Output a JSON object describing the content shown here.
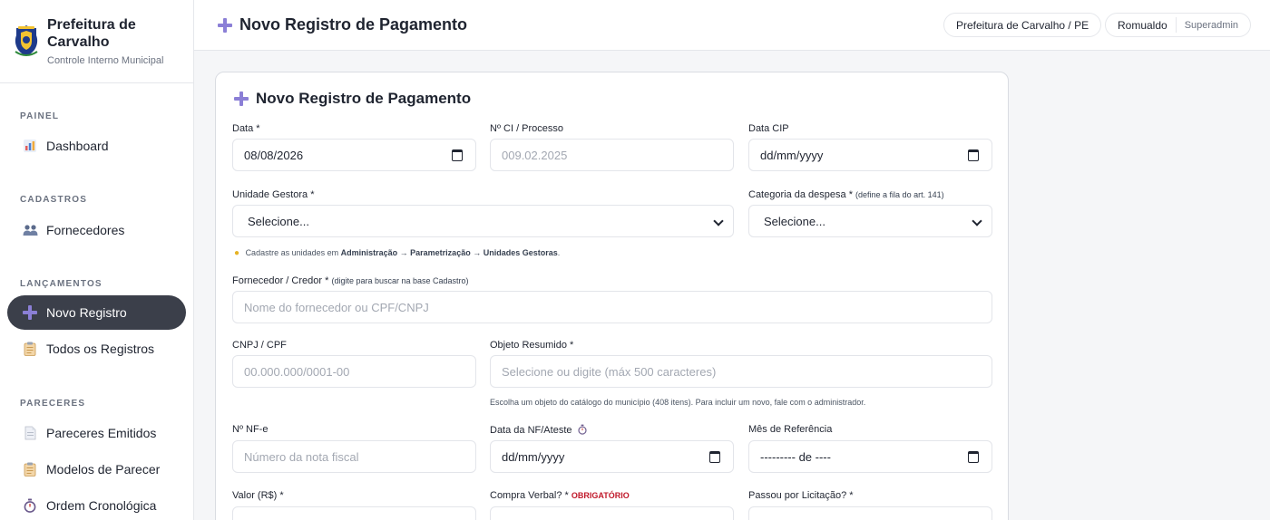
{
  "brand": {
    "title": "Prefeitura de Carvalho",
    "subtitle": "Controle Interno Municipal"
  },
  "sidebar": {
    "sections": [
      {
        "label": "PAINEL"
      },
      {
        "label": "CADASTROS"
      },
      {
        "label": "LANÇAMENTOS"
      },
      {
        "label": "PARECERES"
      }
    ],
    "items": [
      {
        "label": "Dashboard",
        "icon": "bar-chart-icon"
      },
      {
        "label": "Fornecedores",
        "icon": "users-icon"
      },
      {
        "label": "Novo Registro",
        "icon": "plus-icon"
      },
      {
        "label": "Todos os Registros",
        "icon": "clipboard-icon"
      },
      {
        "label": "Pareceres Emitidos",
        "icon": "document-icon"
      },
      {
        "label": "Modelos de Parecer",
        "icon": "clipboard-icon"
      },
      {
        "label": "Ordem Cronológica",
        "icon": "stopwatch-icon"
      }
    ]
  },
  "topbar": {
    "title": "Novo Registro de Pagamento",
    "org": "Prefeitura de Carvalho / PE",
    "user": "Romualdo",
    "role": "Superadmin"
  },
  "form": {
    "title": "Novo Registro de Pagamento",
    "data_label": "Data *",
    "data_value": "08/08/2026",
    "ci_label": "Nº CI / Processo",
    "ci_placeholder": "009.02.2025",
    "cip_label": "Data CIP",
    "cip_value": "dd/mm/yyyy",
    "unidade_label": "Unidade Gestora *",
    "unidade_value": "Selecione...",
    "categoria_label": "Categoria da despesa *",
    "categoria_hint": "(define a fila do art. 141)",
    "categoria_value": "Selecione...",
    "cadastre_note_prefix": "Cadastre as unidades em",
    "cadastre_note_path": "Administração → Parametrização → Unidades Gestoras",
    "cadastre_note_suffix": ".",
    "fornecedor_label": "Fornecedor / Credor *",
    "fornecedor_hint": "(digite para buscar na base Cadastro)",
    "fornecedor_placeholder": "Nome do fornecedor ou CPF/CNPJ",
    "cnpj_label": "CNPJ / CPF",
    "cnpj_placeholder": "00.000.000/0001-00",
    "objeto_label": "Objeto Resumido *",
    "objeto_placeholder": "Selecione ou digite (máx 500 caracteres)",
    "objeto_note": "Escolha um objeto do catálogo do município (408 itens). Para incluir um novo, fale com o administrador.",
    "nfe_label": "Nº NF-e",
    "nfe_placeholder": "Número da nota fiscal",
    "data_nf_label": "Data da NF/Ateste",
    "data_nf_value": "dd/mm/yyyy",
    "mes_ref_label": "Mês de Referência",
    "mes_ref_value": "--------- de ----",
    "valor_label": "Valor (R$) *",
    "compra_label": "Compra Verbal? *",
    "compra_tag": "OBRIGATÓRIO",
    "licitacao_label": "Passou por Licitação? *"
  }
}
